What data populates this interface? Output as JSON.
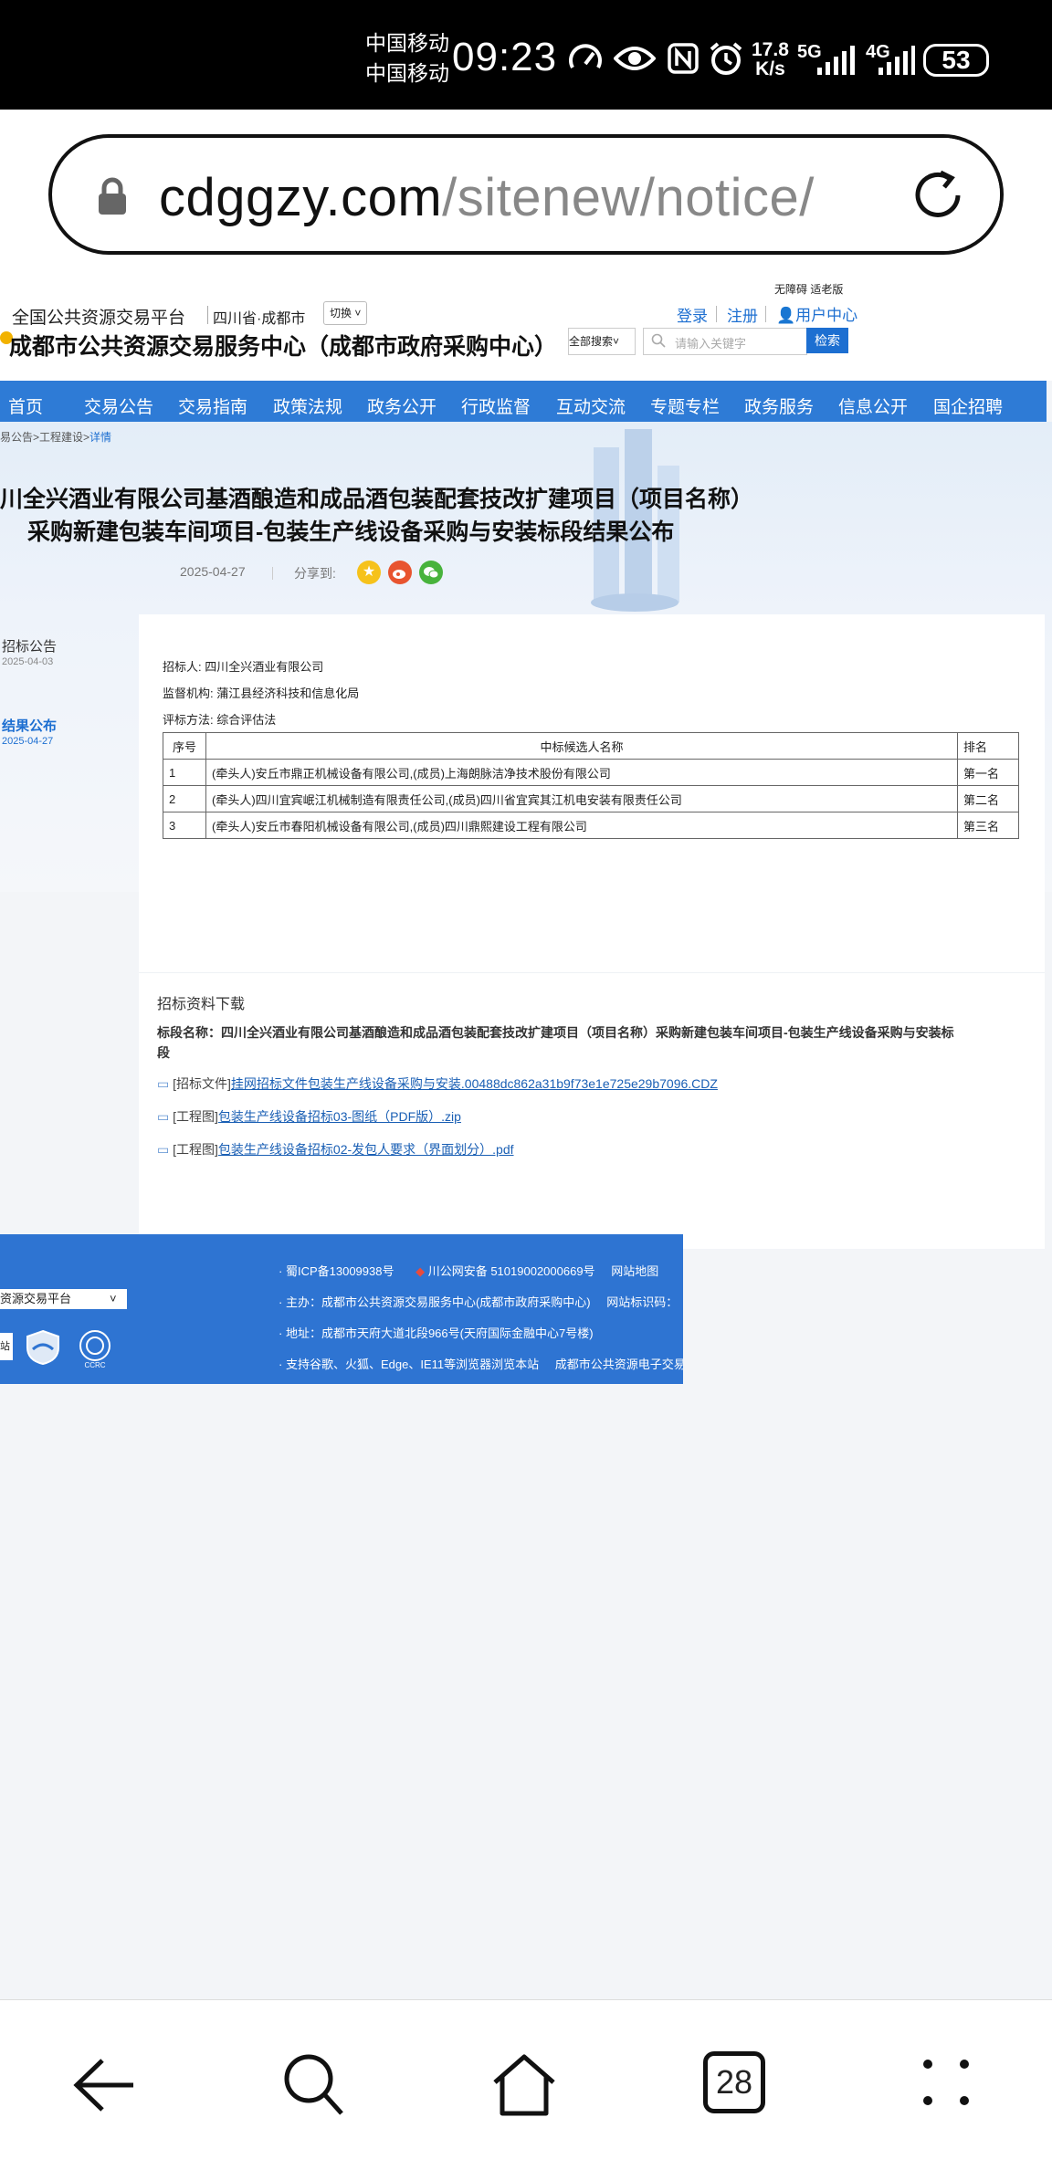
{
  "status_bar": {
    "carrier_1": "中国移动",
    "carrier_2": "中国移动",
    "time": "09:23",
    "net_speed_value": "17.8",
    "net_speed_unit": "K/s",
    "signal_1": "5G",
    "signal_2": "4G",
    "battery": "53"
  },
  "browser": {
    "url_domain": "cdggzy.com",
    "url_path": "/sitenew/notice/",
    "tab_count": "28"
  },
  "site": {
    "top_links": "无障碍 适老版",
    "platform_name": "全国公共资源交易平台",
    "region": "四川省·成都市",
    "switch_label": "切换",
    "login": "登录",
    "register": "注册",
    "user_center": "用户中心",
    "title": "成都市公共资源交易服务中心（成都市政府采购中心）",
    "search_scope": "全部搜索",
    "search_placeholder": "请输入关键字",
    "search_button": "检索",
    "nav": [
      "首页",
      "交易公告",
      "交易指南",
      "政策法规",
      "政务公开",
      "行政监督",
      "互动交流",
      "专题专栏",
      "政务服务",
      "信息公开",
      "国企招聘"
    ]
  },
  "breadcrumb": {
    "prefix": "易公告>工程建设>",
    "current": "详情"
  },
  "notice": {
    "title_line1": "川全兴酒业有限公司基酒酿造和成品酒包装配套技改扩建项目（项目名称）",
    "title_line2": "采购新建包装车间项目-包装生产线设备采购与安装标段结果公布",
    "date": "2025-04-27",
    "share_label": "分享到:"
  },
  "side_timeline": [
    {
      "label": "招标公告",
      "date": "2025-04-03"
    },
    {
      "label": "结果公布",
      "date": "2025-04-27"
    }
  ],
  "detail": {
    "tenderer_label": "招标人:",
    "tenderer": "四川全兴酒业有限公司",
    "supervisor_label": "监督机构:",
    "supervisor": "蒲江县经济科技和信息化局",
    "method_label": "评标方法:",
    "method": "综合评估法",
    "table_headers": [
      "序号",
      "中标候选人名称",
      "排名"
    ],
    "table_rows": [
      [
        "1",
        "(牵头人)安丘市鼎正机械设备有限公司,(成员)上海朗脉洁净技术股份有限公司",
        "第一名"
      ],
      [
        "2",
        "(牵头人)四川宜宾岷江机械制造有限责任公司,(成员)四川省宜宾其江机电安装有限责任公司",
        "第二名"
      ],
      [
        "3",
        "(牵头人)安丘市春阳机械设备有限公司,(成员)四川鼎熙建设工程有限公司",
        "第三名"
      ]
    ]
  },
  "downloads": {
    "heading": "招标资料下载",
    "section_line1": "标段名称：四川全兴酒业有限公司基酒酿造和成品酒包装配套技改扩建项目（项目名称）采购新建包装车间项目-包装生产线设备采购与安装标",
    "section_line2": "段",
    "items": [
      {
        "tag": "[招标文件]",
        "name": "挂网招标文件包装生产线设备采购与安装.00488dc862a31b9f73e1e725e29b7096.CDZ"
      },
      {
        "tag": "[工程图]",
        "name": "包装生产线设备招标03-图纸（PDF版）.zip"
      },
      {
        "tag": "[工程图]",
        "name": "包装生产线设备招标02-发包人要求（界面划分）.pdf"
      }
    ]
  },
  "footer": {
    "select_value": "资源交易平台",
    "input_fragment": "站",
    "icp": "蜀ICP备13009938号",
    "police": "川公网安备 51019002000669号",
    "sitemap": "网站地图",
    "host": "主办：成都市公共资源交易服务中心(成都市政府采购中心)",
    "site_id_label": "网站标识码：",
    "address": "地址：成都市天府大道北段966号(天府国际金融中心7号楼)",
    "browser_support": "支持谷歌、火狐、Edge、IE11等浏览器浏览本站",
    "e_platform": "成都市公共资源电子交易",
    "badge_text": "CCRC"
  },
  "colors": {
    "nav_blue": "#2e7bd6",
    "footer_blue": "#2e74d2",
    "search_button": "#1d6fd1",
    "link_blue": "#1a5fb4"
  }
}
